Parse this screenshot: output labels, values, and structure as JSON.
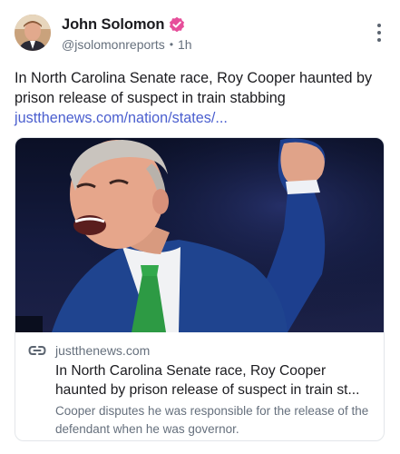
{
  "author": {
    "display_name": "John Solomon",
    "handle": "@jsolomonreports",
    "time": "1h",
    "verified_color": "#e64e9a"
  },
  "post": {
    "text": "In North Carolina Senate race, Roy Cooper haunted by prison release of suspect in train stabbing",
    "link_text": "justthenews.com/nation/states/..."
  },
  "card": {
    "domain": "justthenews.com",
    "title_line1": "In North Carolina Senate race, Roy Cooper",
    "title_line2": "haunted by prison release of suspect in train st...",
    "description": "Cooper disputes he was responsible for the release of the defendant when he was governor."
  },
  "icons": {
    "verified": "verified-badge-icon",
    "more": "more-vertical-icon",
    "link": "link-icon"
  },
  "colors": {
    "link": "#4b5fcf",
    "muted": "#66707d",
    "text": "#1b1b1f"
  }
}
